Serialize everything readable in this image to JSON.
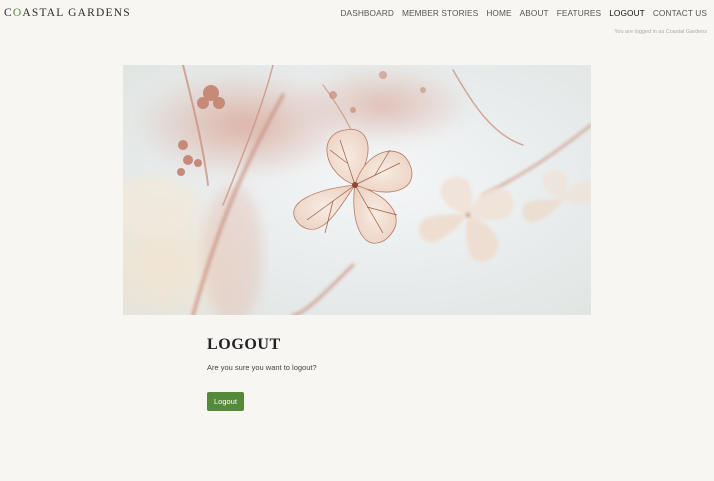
{
  "brand": {
    "logo_first": "C",
    "logo_second": "O",
    "logo_rest": "ASTAL GARDENS"
  },
  "nav": {
    "items": [
      {
        "label": "DASHBOARD"
      },
      {
        "label": "MEMBER STORIES"
      },
      {
        "label": "HOME"
      },
      {
        "label": "ABOUT"
      },
      {
        "label": "FEATURES"
      },
      {
        "label": "LOGOUT"
      },
      {
        "label": "CONTACT US"
      }
    ],
    "active": "LOGOUT"
  },
  "session": {
    "status": "You are logged in as Coastal Gardens"
  },
  "hero": {
    "image": "dried-hydrangea-flower-photo"
  },
  "main": {
    "title": "LOGOUT",
    "description": "Are you sure you want to logout?",
    "button_label": "Logout"
  },
  "colors": {
    "accent": "#568a3b",
    "background": "#f7f6f2"
  }
}
